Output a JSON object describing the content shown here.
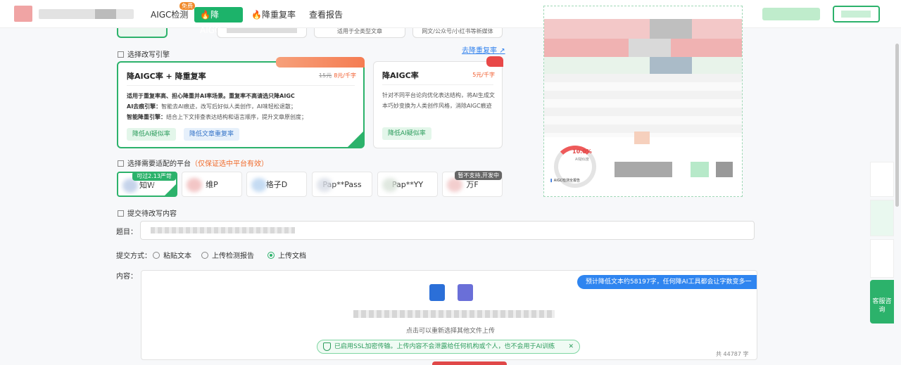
{
  "nav": {
    "items": [
      {
        "label": "AIGC检测",
        "badge": "免费"
      },
      {
        "label": "降AIGC"
      },
      {
        "label": "降重复率"
      },
      {
        "label": "查看报告"
      }
    ],
    "active_color": "#1cb36a"
  },
  "top_stubs": [
    "适用于全类型文章",
    "网文/公众号/小红书等新媒体"
  ],
  "engine": {
    "label": "选择改写引擎",
    "link": "去降重复率",
    "cards": [
      {
        "title": "降AIGC率 + 降重复率",
        "price_old": "15元",
        "price_new": "8元/千字",
        "intro": "适用于重复率高、担心降重并AI率场景。重复率不高请选只降AIGC",
        "line1_key": "AI去痕引擎：",
        "line1_val": "智能去AI痕迹，改写后好似人类创作，AI味轻松退散；",
        "line2_key": "智能降重引擎：",
        "line2_val": "结合上下文排查表达结构和语言顺序，提升文章原创度；",
        "tags": [
          "降低AI疑似率",
          "降低文章重复率"
        ]
      },
      {
        "title": "降AIGC率",
        "price_new": "5元/千字",
        "desc": "针对不同平台论向优化表达结构，将AI生成文本巧妙变换为人类创作风格，消除AIGC痕迹",
        "tags": [
          "降低AI疑似率"
        ]
      }
    ]
  },
  "platform": {
    "label": "选择需要适配的平台",
    "tip": "（仅保证选中平台有效）",
    "items": [
      {
        "name": "知W",
        "badge": "可过2.13严苛版"
      },
      {
        "name": "维P"
      },
      {
        "name": "格子D"
      },
      {
        "name": "Pap**Pass"
      },
      {
        "name": "Pap**YY"
      },
      {
        "name": "万F",
        "badge": "暂不支持,开发中"
      }
    ]
  },
  "submit": {
    "label": "提交待改写内容",
    "title_label": "题目：",
    "mode_label": "提交方式：",
    "modes": [
      "粘贴文本",
      "上传检测报告",
      "上传文档"
    ],
    "selected_mode": "上传文档",
    "content_label": "内容：",
    "estimate_tip": "预计降低文本约58197字，任何降AI工具都会让字数变多一",
    "reupload_hint": "点击可以重新选择其他文件上传",
    "ssl_notice": "已启用SSL加密传输。上传内容不会泄露给任何机构或个人，也不会用于AI训练",
    "ssl_close": "✕",
    "char_count": "共 44787 字"
  },
  "preview": {
    "percent": "10.0%",
    "percent_caption": "AI疑似度",
    "footer": "AIGC检测全报告"
  },
  "side": {
    "service_label": "客服咨询"
  }
}
